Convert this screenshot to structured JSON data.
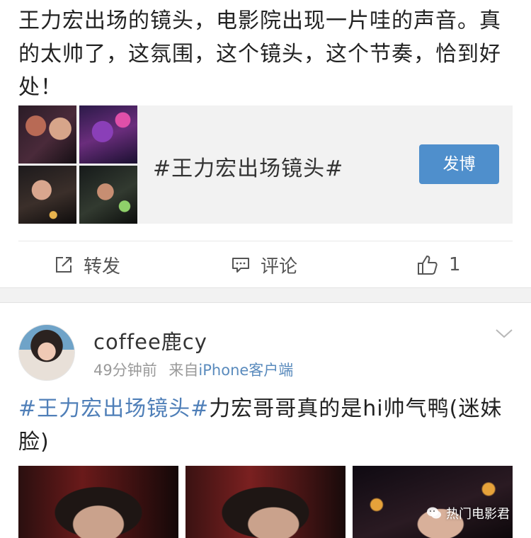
{
  "post1": {
    "text": "王力宏出场的镜头，电影院出现一片哇的声音。真的太帅了，这氛围，这个镜头，这个节奏，恰到好处！",
    "topic_card": {
      "title": "#王力宏出场镜头#",
      "button_label": "发博"
    },
    "actions": {
      "repost_label": "转发",
      "comment_label": "评论",
      "like_count": "1"
    }
  },
  "post2": {
    "username": "coffee鹿cy",
    "time": "49分钟前",
    "source_prefix": "来自",
    "source": "iPhone客户端",
    "topic": "#王力宏出场镜头#",
    "text": "力宏哥哥真的是hi帅气鸭(迷妹脸)"
  },
  "watermark": {
    "text": "热门电影君"
  },
  "icons": {
    "repost": "repost-icon",
    "comment": "comment-icon",
    "like": "thumbs-up-icon",
    "dropdown": "chevron-down-icon",
    "watermark": "wechat-icon"
  },
  "colors": {
    "accent": "#4f8fcc",
    "link": "#4f7fb8",
    "source": "#5a8bbd"
  }
}
